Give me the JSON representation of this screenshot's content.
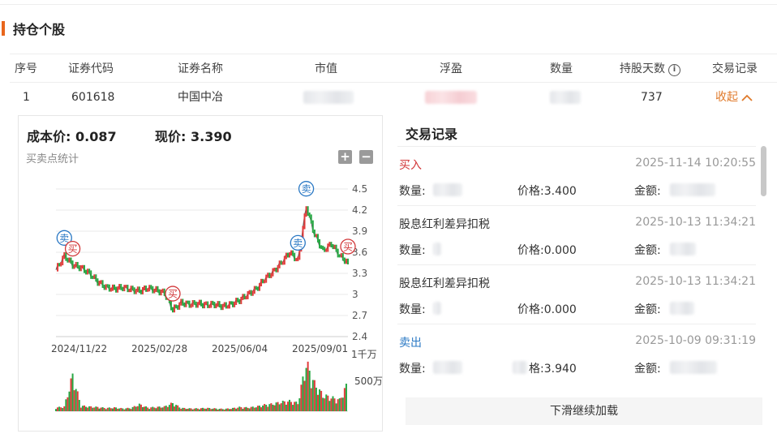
{
  "section": {
    "title": "持仓个股"
  },
  "table": {
    "headers": [
      "序号",
      "证券代码",
      "证券名称",
      "市值",
      "浮盈",
      "数量",
      "持股天数",
      "交易记录"
    ],
    "row": {
      "index": "1",
      "code": "601618",
      "name": "中国中冶",
      "days": "737",
      "collapse_label": "收起"
    }
  },
  "summary": {
    "cost_label": "成本价:",
    "cost_value": "0.087",
    "current_label": "现价:",
    "current_value": "3.390",
    "stat_label": "买卖点统计",
    "zoom_in": "+",
    "zoom_out": "−"
  },
  "chart_data": {
    "type": "line",
    "x_ticks": [
      "2024/11/22",
      "2025/02/28",
      "2025/06/04",
      "2025/09/01"
    ],
    "y_ticks": [
      4.5,
      4.2,
      3.9,
      3.6,
      3.3,
      3,
      2.7,
      2.4
    ],
    "ylim": [
      2.4,
      4.5
    ],
    "volume_ticks": [
      "1千万",
      "500万"
    ],
    "price_series": [
      3.35,
      3.55,
      3.42,
      3.38,
      3.3,
      3.18,
      3.1,
      3.08,
      3.1,
      3.07,
      3.05,
      3.09,
      3.06,
      3.02,
      2.78,
      2.88,
      2.86,
      2.87,
      2.85,
      2.86,
      2.83,
      2.86,
      2.92,
      3.0,
      3.08,
      3.22,
      3.32,
      3.45,
      3.6,
      3.48,
      4.25,
      3.85,
      3.62,
      3.72,
      3.55,
      3.45
    ],
    "volume_series": [
      0.08,
      0.1,
      0.78,
      0.12,
      0.1,
      0.09,
      0.07,
      0.08,
      0.06,
      0.07,
      0.15,
      0.08,
      0.09,
      0.1,
      0.18,
      0.07,
      0.06,
      0.06,
      0.07,
      0.06,
      0.05,
      0.06,
      0.09,
      0.08,
      0.1,
      0.14,
      0.16,
      0.2,
      0.22,
      0.18,
      1.05,
      0.6,
      0.35,
      0.3,
      0.25,
      0.62
    ],
    "markers": [
      {
        "label": "卖",
        "type": "sell",
        "index": 1
      },
      {
        "label": "买",
        "type": "buy",
        "index": 2
      },
      {
        "label": "买",
        "type": "buy",
        "index": 14
      },
      {
        "label": "卖",
        "type": "sell",
        "index": 29
      },
      {
        "label": "卖",
        "type": "sell",
        "index": 30
      },
      {
        "label": "买",
        "type": "buy",
        "index": 35
      }
    ],
    "colors": {
      "up": "#e23b3b",
      "down": "#27a844",
      "sell": "#2a78c4",
      "buy": "#d2383a",
      "line": "#555555"
    }
  },
  "records": {
    "title": "交易记录",
    "items": [
      {
        "type": "买入",
        "kind": "buy",
        "time": "2025-11-14 10:20:55",
        "qty_label": "数量:",
        "price_label": "价格:",
        "price": "3.400",
        "amount_label": "金额:"
      },
      {
        "type": "股息红利差异扣税",
        "kind": "other",
        "time": "2025-10-13 11:34:21",
        "qty_label": "数量:",
        "price_label": "价格:",
        "price": "0.000",
        "amount_label": "金额:"
      },
      {
        "type": "股息红利差异扣税",
        "kind": "other",
        "time": "2025-10-13 11:34:21",
        "qty_label": "数量:",
        "price_label": "价格:",
        "price": "0.000",
        "amount_label": "金额:"
      },
      {
        "type": "卖出",
        "kind": "sell",
        "time": "2025-10-09 09:31:19",
        "qty_label": "数量:",
        "price_label": "格:",
        "price": "3.940",
        "amount_label": "金额:"
      }
    ],
    "load_more": "下滑继续加载"
  }
}
